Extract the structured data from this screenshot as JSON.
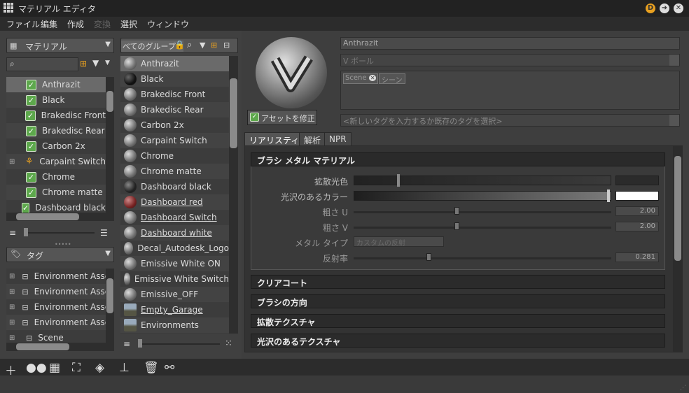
{
  "window": {
    "title": "マテリアル エディタ"
  },
  "menu": [
    "ファイル",
    "編集",
    "作成",
    "変換",
    "選択",
    "ウィンドウ"
  ],
  "left": {
    "material_dropdown": "マテリアル",
    "materials": [
      "Anthrazit",
      "Black",
      "Brakedisc Front",
      "Brakedisc Rear",
      "Carbon 2x",
      "Carpaint Switch",
      "Chrome",
      "Chrome matte",
      "Dashboard black"
    ],
    "tag_dropdown": "タグ",
    "tags": [
      "Environment Asse",
      "Environment Asse",
      "Environment Asse",
      "Environment Asse",
      "Scene"
    ]
  },
  "middle": {
    "group_dropdown": "べてのグループ>",
    "items": [
      "Anthrazit",
      "Black",
      "Brakedisc Front",
      "Brakedisc Rear",
      "Carbon 2x",
      "Carpaint Switch",
      "Chrome",
      "Chrome matte",
      "Dashboard black",
      "Dashboard red",
      "Dashboard Switch",
      "Dashboard white",
      "Decal_Autodesk_Logo",
      "Emissive White ON",
      "Emissive White Switch",
      "Emissive_OFF",
      "Empty_Garage",
      "Environments"
    ]
  },
  "editor": {
    "name": "Anthrazit",
    "type": "V ボール",
    "tags": [
      "Scene",
      "シーン"
    ],
    "tag_placeholder": "<新しいタグを入力するか既存のタグを選択>",
    "modify_asset": "アセットを修正",
    "tabs": [
      "リアリスティック",
      "解析",
      "NPR"
    ],
    "section_title": "ブラシ メタル マテリアル",
    "props": {
      "diffuse": "拡散光色",
      "glossy": "光沢のあるカラー",
      "rough_u": "粗さ U",
      "rough_v": "粗さ V",
      "metal_type": "メタル タイプ",
      "metal_type_value": "カスタムの反射",
      "reflectivity": "反射率"
    },
    "values": {
      "rough_u": "2.00",
      "rough_v": "2.00",
      "reflectivity": "0.281"
    },
    "sections": [
      "クリアコート",
      "ブラシの方向",
      "拡散テクスチャ",
      "光沢のあるテクスチャ"
    ]
  },
  "colors": {
    "accent_check": "#5da84c",
    "title_bg": "#222222"
  }
}
